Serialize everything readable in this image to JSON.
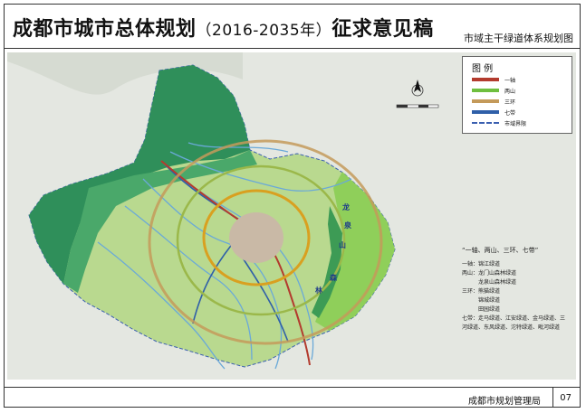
{
  "header": {
    "title_main": "成都市城市总体规划",
    "title_years": "（2016-2035年）",
    "title_suffix": "征求意见稿",
    "subtitle": "市域主干绿道体系规划图"
  },
  "legend": {
    "title": "图  例",
    "items": [
      {
        "label": "一轴",
        "color": "#b33b2e"
      },
      {
        "label": "两山",
        "color": "#6fbf3f"
      },
      {
        "label": "三环",
        "color": "#c49a5a"
      },
      {
        "label": "七带",
        "color": "#2f5fa8"
      },
      {
        "label": "市域界限",
        "color": "#3a5fb0"
      }
    ]
  },
  "notes": {
    "heading": "“一轴、两山、三环、七带”",
    "lines": [
      "一轴：锦江绿道",
      "两山：龙门山森林绿道",
      "　　　龙泉山森林绿道",
      "三环：熊猫绿道",
      "　　　锦城绿道",
      "　　　田园绿道",
      "七带：走马绿道、江安绿道、金马绿道、三",
      "河绿道、东风绿道、沱特绿道、毗河绿道"
    ]
  },
  "map_labels": {
    "lqs_1": "龙",
    "lqs_2": "泉",
    "lqs_3": "山",
    "lqs_4": "森",
    "lqs_5": "林"
  },
  "footer": {
    "organization": "成都市规划管理局",
    "page": "07"
  },
  "colors": {
    "mountain_dark": "#2f8f5a",
    "mountain_mid": "#4aa86a",
    "plain": "#b9d98f",
    "east_hills": "#8fcf5a",
    "water": "#6aa9d8",
    "panda_ring": "#c49a5a",
    "city": "#c9b9a6"
  }
}
